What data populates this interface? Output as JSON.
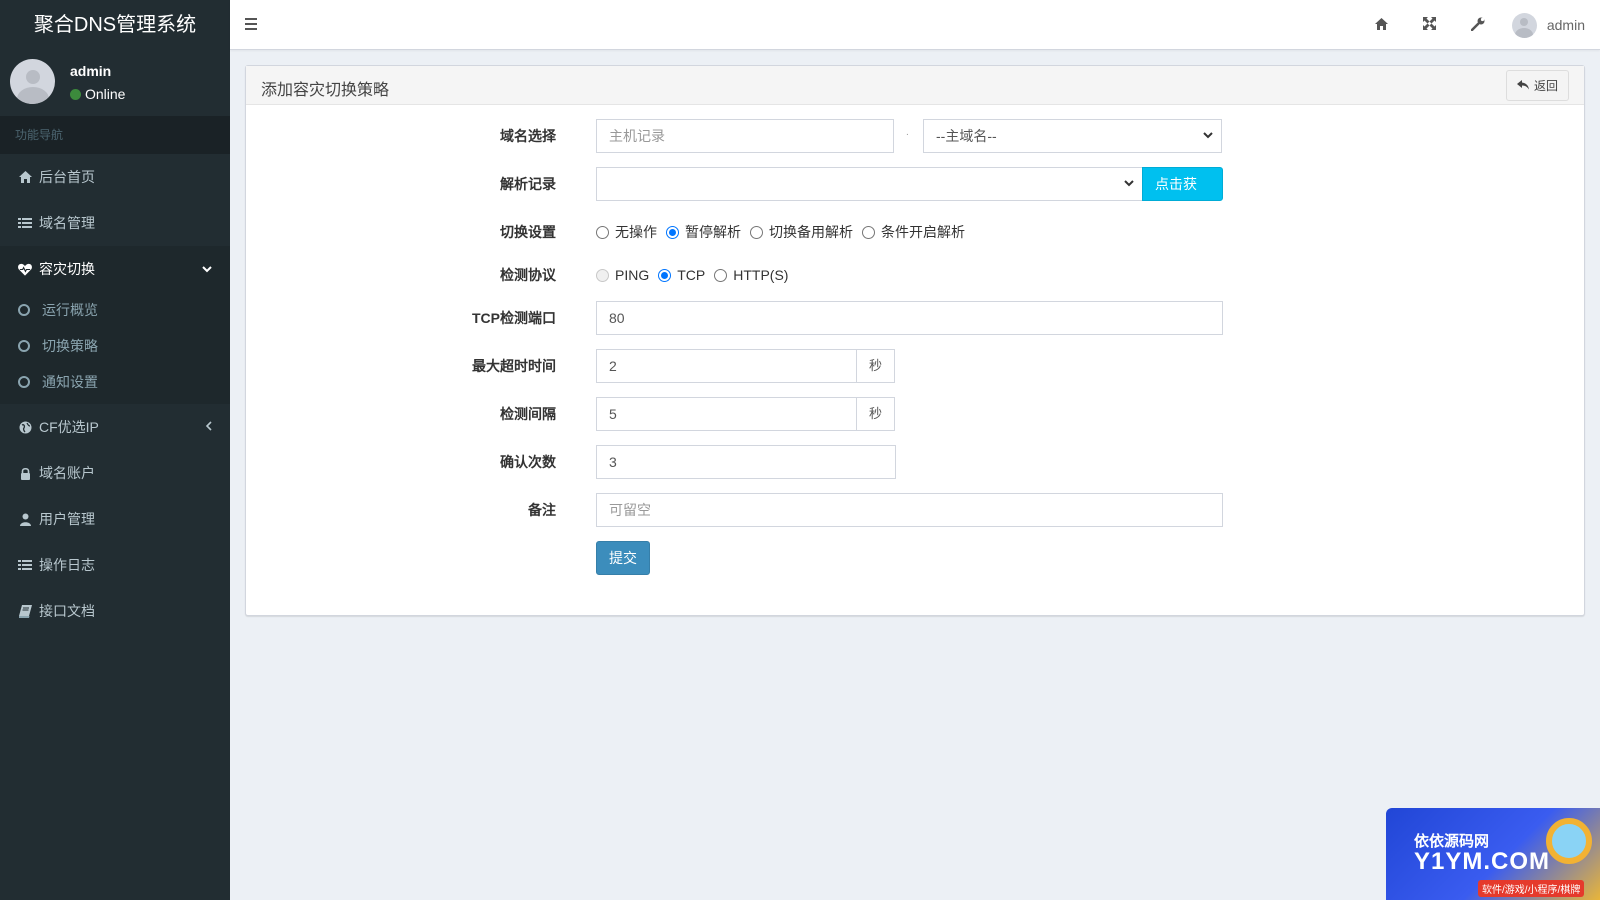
{
  "app": {
    "title": "聚合DNS管理系统"
  },
  "user_panel": {
    "name": "admin",
    "status": "Online",
    "status_color": "#3c8a3c"
  },
  "sidebar": {
    "header": "功能导航",
    "items": [
      {
        "label": "后台首页",
        "icon": "home-icon"
      },
      {
        "label": "域名管理",
        "icon": "list-icon"
      },
      {
        "label": "容灾切换",
        "icon": "heartbeat-icon",
        "active": true,
        "expanded": true,
        "children": [
          {
            "label": "运行概览"
          },
          {
            "label": "切换策略"
          },
          {
            "label": "通知设置"
          }
        ]
      },
      {
        "label": "CF优选IP",
        "icon": "globe-icon",
        "collapsed": true
      },
      {
        "label": "域名账户",
        "icon": "lock-icon"
      },
      {
        "label": "用户管理",
        "icon": "user-icon"
      },
      {
        "label": "操作日志",
        "icon": "list-icon"
      },
      {
        "label": "接口文档",
        "icon": "book-icon"
      }
    ]
  },
  "topbar": {
    "icons": [
      "home-icon",
      "fullscreen-icon",
      "wrench-icon"
    ],
    "username": "admin"
  },
  "form_box": {
    "title": "添加容灾切换策略",
    "back_label": "返回",
    "fields": {
      "domain": {
        "label": "域名选择",
        "host_placeholder": "主机记录",
        "host_value": "",
        "separator": ".",
        "main_domain_selected": "--主域名--"
      },
      "record": {
        "label": "解析记录",
        "selected": "",
        "fetch_label": "点击获取"
      },
      "switch_setting": {
        "label": "切换设置",
        "options": [
          "无操作",
          "暂停解析",
          "切换备用解析",
          "条件开启解析"
        ],
        "selected": "暂停解析"
      },
      "protocol": {
        "label": "检测协议",
        "options": [
          "PING",
          "TCP",
          "HTTP(S)"
        ],
        "selected": "TCP",
        "disabled": [
          "PING"
        ]
      },
      "tcp_port": {
        "label": "TCP检测端口",
        "value": "80"
      },
      "timeout": {
        "label": "最大超时时间",
        "value": "2",
        "unit": "秒"
      },
      "interval": {
        "label": "检测间隔",
        "value": "5",
        "unit": "秒"
      },
      "confirm_count": {
        "label": "确认次数",
        "value": "3"
      },
      "remark": {
        "label": "备注",
        "placeholder": "可留空",
        "value": ""
      }
    },
    "submit_label": "提交"
  },
  "watermark": {
    "line1": "依依源码网",
    "line2": "Y1YM.COM",
    "line3": "软件/游戏/小程序/棋牌"
  },
  "colors": {
    "sidebar_bg": "#222d32",
    "info_button": "#00c0ef",
    "primary_button": "#3c8dbc",
    "radio_checked": "#0075ff",
    "page_bg": "#ecf0f5"
  }
}
